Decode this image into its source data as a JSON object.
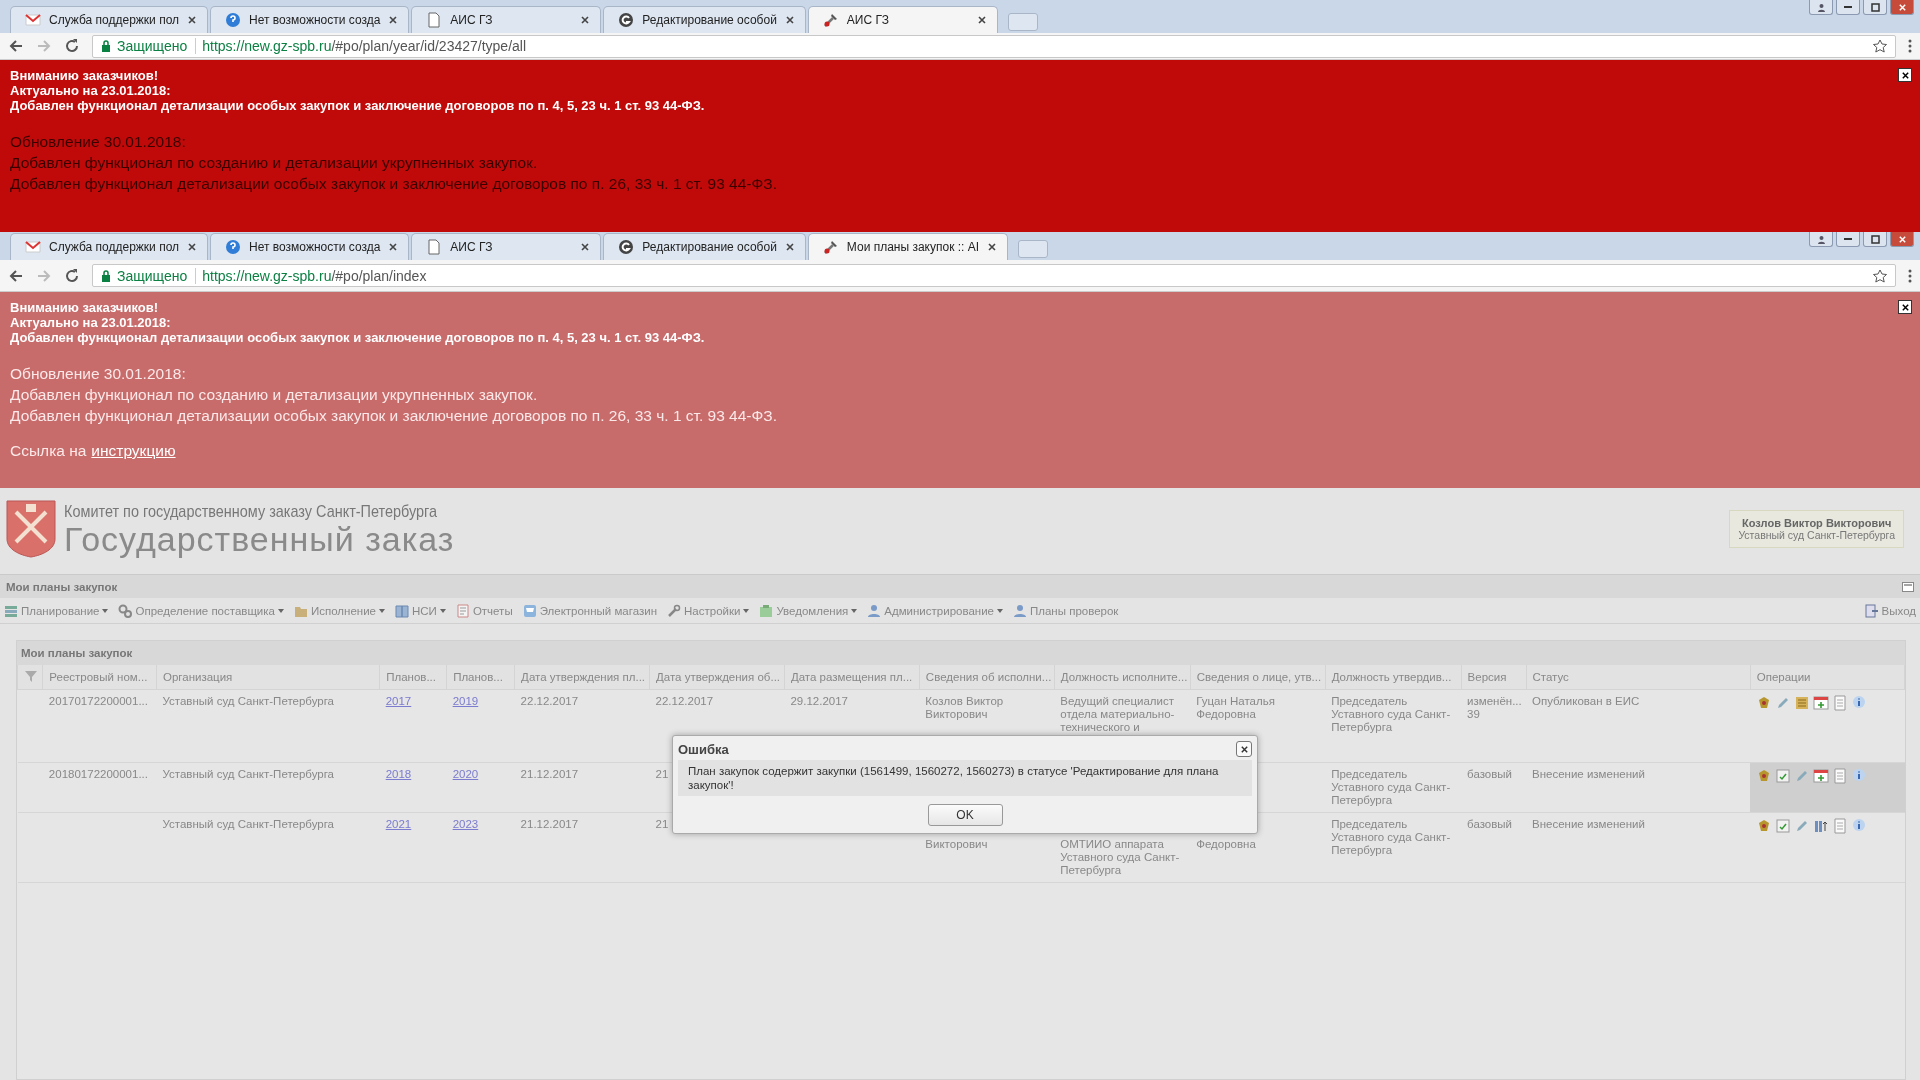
{
  "windows": [
    {
      "tabs": [
        {
          "label": "Служба поддержки пол",
          "selected": false
        },
        {
          "label": "Нет возможности созда",
          "selected": false
        },
        {
          "label": "АИС ГЗ",
          "selected": false
        },
        {
          "label": "Редактирование особой",
          "selected": false
        },
        {
          "label": "АИС ГЗ",
          "selected": true
        }
      ],
      "address": {
        "secure_label": "Защищено",
        "host": "https://new.gz-spb.ru",
        "path": "/#po/plan/year/id/23427/type/all"
      },
      "banner": {
        "dimmed": false,
        "bold_lines": [
          "Вниманию заказчиков!",
          "Актуально на 23.01.2018:",
          "Добавлен функционал детализации особых закупок и заключение договоров по п. 4, 5, 23 ч. 1 ст. 93 44-ФЗ."
        ],
        "lines": [
          "Обновление 30.01.2018:",
          "Добавлен функционал по созданию и детализации укрупненных закупок.",
          "Добавлен функционал детализации особых закупок и заключение договоров по п. 26, 33 ч. 1 ст. 93 44-ФЗ."
        ]
      }
    },
    {
      "tabs": [
        {
          "label": "Служба поддержки пол",
          "selected": false
        },
        {
          "label": "Нет возможности созда",
          "selected": false
        },
        {
          "label": "АИС ГЗ",
          "selected": false
        },
        {
          "label": "Редактирование особой",
          "selected": false
        },
        {
          "label": "Мои планы закупок :: АІ",
          "selected": true
        }
      ],
      "address": {
        "secure_label": "Защищено",
        "host": "https://new.gz-spb.ru",
        "path": "/#po/plan/index"
      },
      "banner": {
        "dimmed": true,
        "bold_lines": [
          "Вниманию заказчиков!",
          "Актуально на 23.01.2018:",
          "Добавлен функционал детализации особых закупок и заключение договоров по п. 4, 5, 23 ч. 1 ст. 93 44-ФЗ."
        ],
        "lines": [
          "Обновление 30.01.2018:",
          "Добавлен функционал по созданию и детализации укрупненных закупок.",
          "Добавлен функционал детализации особых закупок и заключение договоров по п. 26, 33 ч. 1 ст. 93 44-ФЗ."
        ],
        "link_prefix": "Ссылка на",
        "link": "инструкцию"
      }
    }
  ],
  "header": {
    "subtitle": "Комитет по государственному заказу Санкт-Петербурга",
    "title": "Государственный заказ",
    "user_name": "Козлов Виктор Викторович",
    "user_org": "Уставный суд Санкт-Петербурга"
  },
  "section_title": "Мои планы закупок",
  "toolbar": [
    {
      "label": "Планирование",
      "dropdown": true
    },
    {
      "label": "Определение поставщика",
      "dropdown": true
    },
    {
      "label": "Исполнение",
      "dropdown": true
    },
    {
      "label": "НСИ",
      "dropdown": true
    },
    {
      "label": "Отчеты",
      "dropdown": false
    },
    {
      "label": "Электронный магазин",
      "dropdown": false
    },
    {
      "label": "Настройки",
      "dropdown": true
    },
    {
      "label": "Уведомления",
      "dropdown": true
    },
    {
      "label": "Администрирование",
      "dropdown": true
    },
    {
      "label": "Планы проверок",
      "dropdown": false
    }
  ],
  "exit_label": "Выход",
  "grid": {
    "title": "Мои планы закупок",
    "columns": [
      "Реестровый ном...",
      "Организация",
      "Планов...",
      "Планов...",
      "Дата утверждения пл...",
      "Дата утверждения об...",
      "Дата размещения пл...",
      "Сведения об исполни...",
      "Должность исполните...",
      "Сведения о лице, утв...",
      "Должность утвердив...",
      "Версия",
      "Статус",
      "Операции"
    ],
    "rows": [
      {
        "highlighted": false,
        "cells": [
          {
            "text": "20170172200001..."
          },
          {
            "text": "Уставный суд Санкт-Петербурга"
          },
          {
            "text": "2017",
            "link": true
          },
          {
            "text": "2019",
            "link": true
          },
          {
            "text": "22.12.2017"
          },
          {
            "text": "22.12.2017"
          },
          {
            "text": "29.12.2017"
          },
          {
            "text": "Козлов Виктор Викторович"
          },
          {
            "text": "Ведущий специалист отдела материально-технического и"
          },
          {
            "text": "Гуцан Наталья Федоровна"
          },
          {
            "text": "Председатель Уставного суда Санкт-Петербурга"
          },
          {
            "text": "изменён... 39"
          },
          {
            "text": "Опубликован в ЕИС"
          }
        ]
      },
      {
        "highlighted": true,
        "cells": [
          {
            "text": "20180172200001..."
          },
          {
            "text": "Уставный суд Санкт-Петербурга"
          },
          {
            "text": "2018",
            "link": true
          },
          {
            "text": "2020",
            "link": true
          },
          {
            "text": "21.12.2017"
          },
          {
            "text": "21"
          },
          {},
          {},
          {},
          {},
          {
            "text": "Председатель Уставного суда Санкт-Петербурга"
          },
          {
            "text": "базовый"
          },
          {
            "text": "Внесение изменений"
          }
        ]
      },
      {
        "highlighted": false,
        "cells": [
          {},
          {
            "text": "Уставный суд Санкт-Петербурга"
          },
          {
            "text": "2021",
            "link": true
          },
          {
            "text": "2023",
            "link": true
          },
          {
            "text": "21.12.2017"
          },
          {
            "text": "21"
          },
          {},
          {
            "text": "Викторович",
            "covered_top": true
          },
          {
            "text": "ОМТИИО аппарата Уставного суда Санкт-Петербурга",
            "covered_top": true
          },
          {
            "text": "Федоровна",
            "covered_top": true
          },
          {
            "text": "Председатель Уставного суда Санкт-Петербурга"
          },
          {
            "text": "базовый"
          },
          {
            "text": "Внесение изменений"
          }
        ]
      }
    ]
  },
  "dialog": {
    "title": "Ошибка",
    "message": "План закупок содержит закупки (1561499, 1560272, 1560273) в статусе 'Редактирование для плана закупок'!",
    "button": "OK"
  }
}
